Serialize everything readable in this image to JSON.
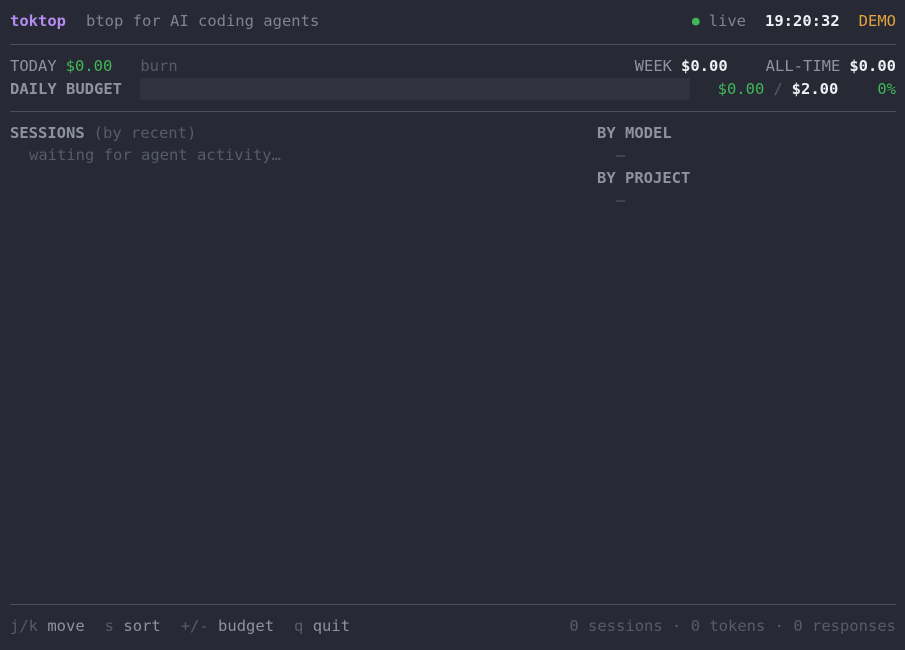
{
  "header": {
    "app_name": "toktop",
    "tagline": "btop for AI coding agents",
    "status_dot": "●",
    "status": "live",
    "clock": "19:20:32",
    "mode": "DEMO"
  },
  "summary": {
    "today_label": "TODAY",
    "today_value": "$0.00",
    "burn_label": "burn",
    "week_label": "WEEK",
    "week_value": "$0.00",
    "alltime_label": "ALL-TIME",
    "alltime_value": "$0.00",
    "budget_label": "DAILY BUDGET",
    "budget_spent": "$0.00",
    "budget_sep": "/",
    "budget_total": "$2.00",
    "budget_percent": "0%",
    "budget_fill": 0
  },
  "sessions": {
    "title": "SESSIONS",
    "sort_note": "(by recent)",
    "empty": "waiting for agent activity…"
  },
  "by_model": {
    "title": "BY MODEL",
    "empty": "—"
  },
  "by_project": {
    "title": "BY PROJECT",
    "empty": "—"
  },
  "footer": {
    "keys": [
      {
        "key": "j/k",
        "action": "move"
      },
      {
        "key": "s",
        "action": "sort"
      },
      {
        "key": "+/-",
        "action": "budget"
      },
      {
        "key": "q",
        "action": "quit"
      }
    ],
    "stats": "0 sessions · 0 tokens · 0 responses"
  },
  "colors": {
    "background": "#272935",
    "brand": "#b48cf2",
    "green": "#3fb855",
    "orange": "#e3a43a"
  }
}
